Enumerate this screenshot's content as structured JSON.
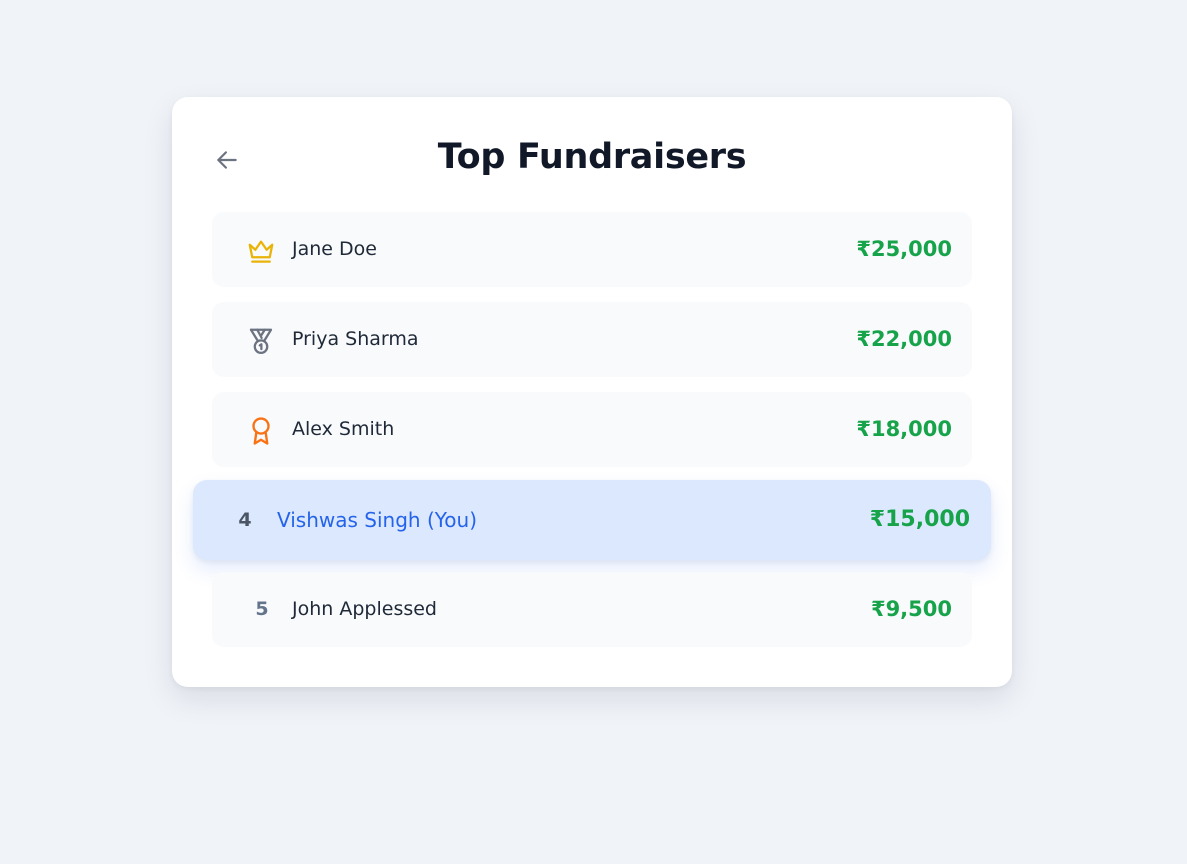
{
  "header": {
    "title": "Top Fundraisers",
    "back_icon": "arrow-left-icon"
  },
  "leaderboard": [
    {
      "rank": "1",
      "icon": "crown-icon",
      "icon_color": "#eab308",
      "name": "Jane Doe",
      "amount": "₹25,000"
    },
    {
      "rank": "2",
      "icon": "medal-icon",
      "icon_color": "#6b7280",
      "name": "Priya Sharma",
      "amount": "₹22,000"
    },
    {
      "rank": "3",
      "icon": "award-ribbon-icon",
      "icon_color": "#f97316",
      "name": "Alex Smith",
      "amount": "₹18,000"
    },
    {
      "rank": "4",
      "name": "Vishwas Singh (You)",
      "amount": "₹15,000",
      "is_current_user": true
    },
    {
      "rank": "5",
      "name": "John Applessed",
      "amount": "₹9,500"
    }
  ],
  "colors": {
    "background": "#f0f4f9",
    "amount": "#16a34a",
    "current_user_highlight": "#dbe8fd",
    "current_user_text": "#2563eb"
  }
}
